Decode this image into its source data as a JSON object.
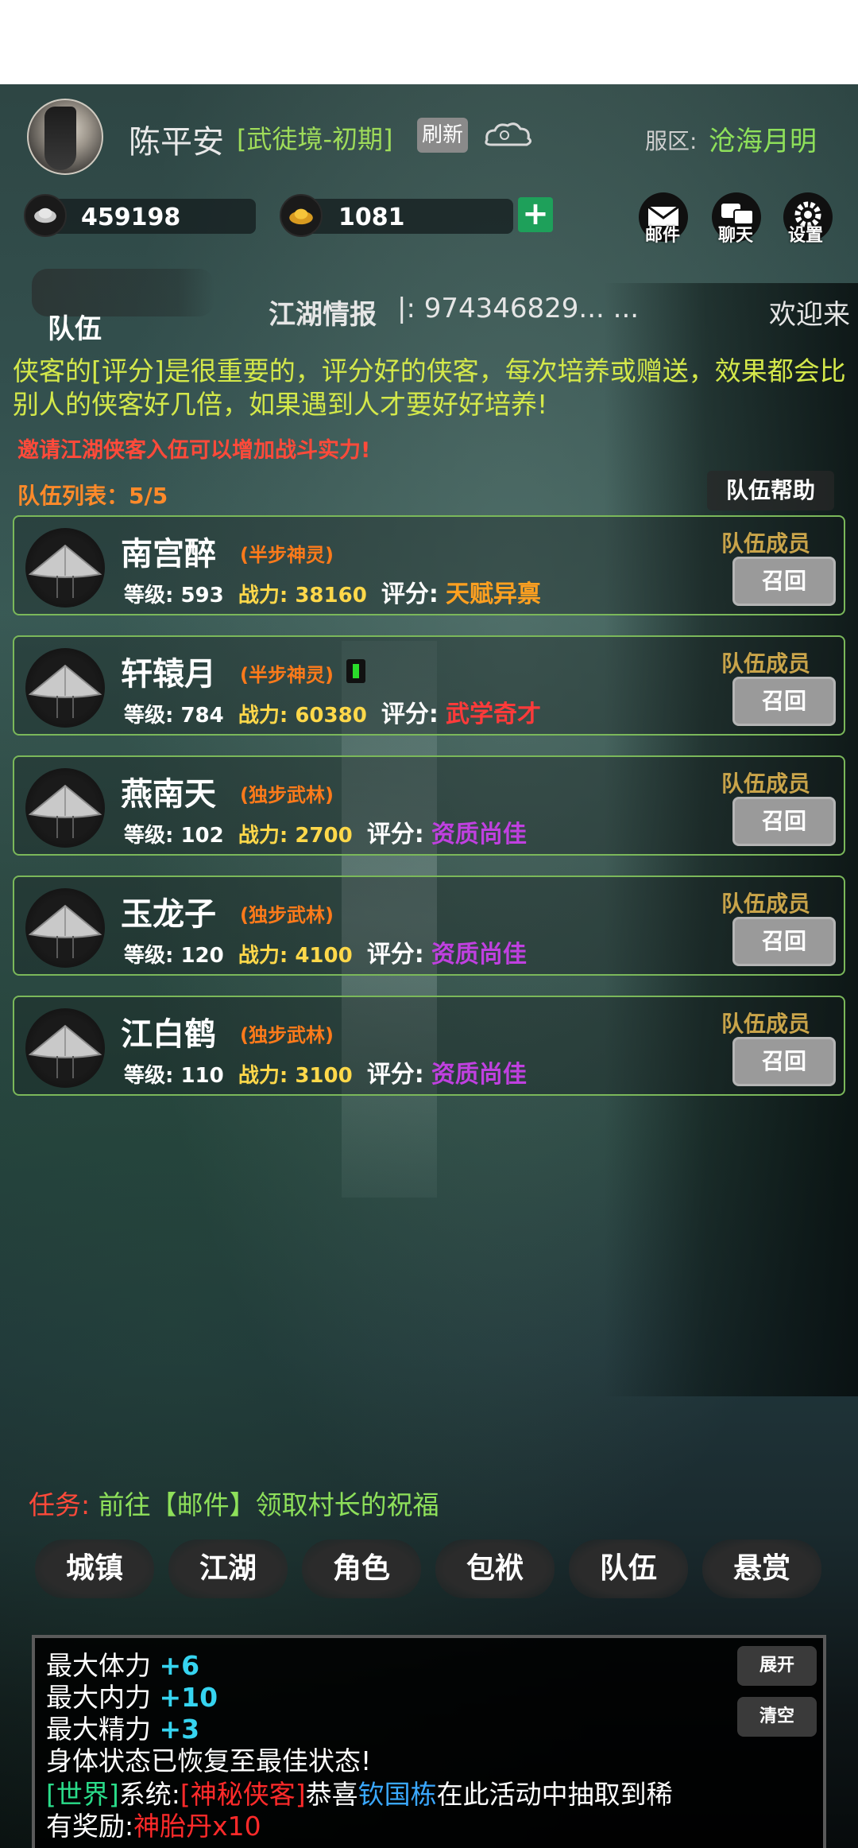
{
  "header": {
    "player_name": "陈平安",
    "realm": "[武徒境-初期]",
    "refresh_label": "刷新",
    "server_label": "服区:",
    "server_name": "沧海月明"
  },
  "currency": {
    "silver": "459198",
    "gold": "1081"
  },
  "top_icons": {
    "mail": "邮件",
    "chat": "聊天",
    "settings": "设置"
  },
  "section_title": "队伍",
  "news": {
    "label": "江湖情报",
    "text": "|:  974346829... ...",
    "welcome": "欢迎来"
  },
  "tip": "侠客的[评分]是很重要的，评分好的侠客，每次培养或赠送，效果都会比别人的侠客好几倍，如果遇到人才要好好培养!",
  "invite": "邀请江湖侠客入伍可以增加战斗实力!",
  "team_count": "队伍列表：5/5",
  "help_label": "队伍帮助",
  "members": [
    {
      "name": "南宫醉",
      "realm": "(半步神灵)",
      "level_label": "等级:",
      "level": "593",
      "power_label": "战力:",
      "power": "38160",
      "score_label": "评分:",
      "score": "天赋异禀",
      "score_color": "#ffa020",
      "role": "队伍成员",
      "recall": "召回",
      "battery": false
    },
    {
      "name": "轩辕月",
      "realm": "(半步神灵)",
      "level_label": "等级:",
      "level": "784",
      "power_label": "战力:",
      "power": "60380",
      "score_label": "评分:",
      "score": "武学奇才",
      "score_color": "#ff3a3a",
      "role": "队伍成员",
      "recall": "召回",
      "battery": true
    },
    {
      "name": "燕南天",
      "realm": "(独步武林)",
      "level_label": "等级:",
      "level": "102",
      "power_label": "战力:",
      "power": "2700",
      "score_label": "评分:",
      "score": "资质尚佳",
      "score_color": "#c040e0",
      "role": "队伍成员",
      "recall": "召回",
      "battery": false
    },
    {
      "name": "玉龙子",
      "realm": "(独步武林)",
      "level_label": "等级:",
      "level": "120",
      "power_label": "战力:",
      "power": "4100",
      "score_label": "评分:",
      "score": "资质尚佳",
      "score_color": "#c040e0",
      "role": "队伍成员",
      "recall": "召回",
      "battery": false
    },
    {
      "name": "江白鹤",
      "realm": "(独步武林)",
      "level_label": "等级:",
      "level": "110",
      "power_label": "战力:",
      "power": "3100",
      "score_label": "评分:",
      "score": "资质尚佳",
      "score_color": "#c040e0",
      "role": "队伍成员",
      "recall": "召回",
      "battery": false
    }
  ],
  "quest": {
    "label": "任务:",
    "text": "前往【邮件】领取村长的祝福"
  },
  "nav": [
    "城镇",
    "江湖",
    "角色",
    "包袱",
    "队伍",
    "悬赏"
  ],
  "log": {
    "line1_label": "最大体力",
    "line1_value": "+6",
    "line2_label": "最大内力",
    "line2_value": "+10",
    "line3_label": "最大精力",
    "line3_value": "+3",
    "line4": "身体状态已恢复至最佳状态!",
    "world_tag": "[世界]",
    "system": "系统:",
    "mystery": "[神秘侠客]",
    "congrats": "恭喜",
    "player": "钦国栋",
    "event": "在此活动中抽取到稀",
    "reward_label": "有奖励:",
    "reward_item": "神胎丹x10",
    "expand": "展开",
    "clear": "清空"
  },
  "colors": {
    "accent_green": "#8ee05a",
    "warn_red": "#ff4a3a",
    "border_green": "#7bb85a"
  }
}
